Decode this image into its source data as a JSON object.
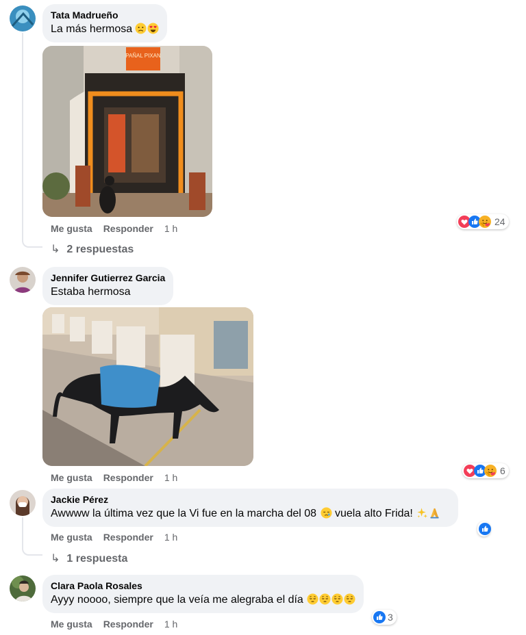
{
  "comments": [
    {
      "author": "Tata Madrueño",
      "text": "La más hermosa",
      "emoji": [
        "sad-face-emoji",
        "heart-eyes-emoji"
      ],
      "photo_sign": "PAÑAL PIXAN",
      "actions": {
        "like": "Me gusta",
        "reply": "Responder",
        "time": "1 h"
      },
      "reactions": {
        "icons": [
          "love",
          "like",
          "care"
        ],
        "count": "24"
      },
      "replies": "2 respuestas"
    },
    {
      "author": "Jennifer Gutierrez Garcia",
      "text": "Estaba hermosa",
      "actions": {
        "like": "Me gusta",
        "reply": "Responder",
        "time": "1 h"
      },
      "reactions": {
        "icons": [
          "love",
          "like",
          "care"
        ],
        "count": "6"
      }
    },
    {
      "author": "Jackie Pérez",
      "text": "Awwww la última vez que la Vi fue en la marcha del 08",
      "text_after": "vuela alto Frida!",
      "emoji": [
        "crying-face-emoji",
        "sparkles-emoji",
        "folded-hands-emoji"
      ],
      "actions": {
        "like": "Me gusta",
        "reply": "Responder",
        "time": "1 h"
      },
      "reactions": {
        "icons": [
          "like"
        ],
        "count": ""
      },
      "replies": "1 respuesta"
    },
    {
      "author": "Clara Paola Rosales",
      "text": "Ayyy noooo, siempre que la veía me alegraba el día",
      "emoji": [
        "pensive-face-emoji",
        "pensive-face-emoji",
        "pensive-face-emoji",
        "pensive-face-emoji"
      ],
      "actions": {
        "like": "Me gusta",
        "reply": "Responder",
        "time": "1 h"
      },
      "reactions": {
        "icons": [
          "like"
        ],
        "count": "3"
      }
    }
  ],
  "colors": {
    "bubble": "#f0f2f5",
    "secondary_text": "#65676b",
    "like_blue": "#1877f2",
    "love_red": "#f33e58",
    "care_yellow": "#f7b125"
  }
}
